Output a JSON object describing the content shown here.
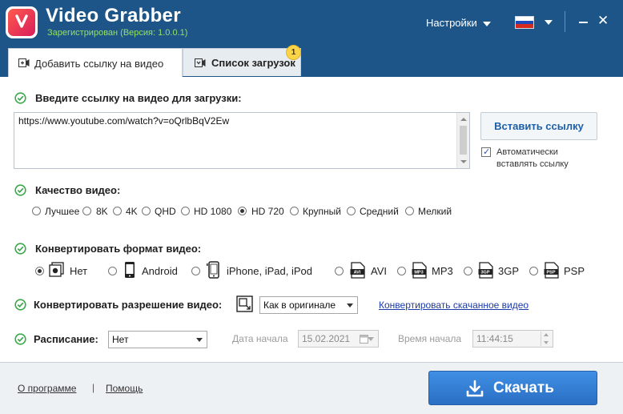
{
  "app": {
    "title": "Video Grabber",
    "subtitle": "Зарегистрирован (Версия: 1.0.0.1)",
    "settings_label": "Настройки",
    "language_flag": "russia-flag-icon"
  },
  "tabs": [
    {
      "label": "Добавить ссылку на видео",
      "active": true,
      "icon": "add-video-icon"
    },
    {
      "label": "Список загрузок",
      "active": false,
      "icon": "download-list-icon",
      "badge": "1"
    }
  ],
  "url_section": {
    "label": "Введите ссылку на видео для загрузки:",
    "value": "https://www.youtube.com/watch?v=oQrlbBqV2Ew",
    "paste_button": "Вставить ссылку",
    "auto_paste_label": "Автоматически вставлять ссылку",
    "auto_paste_checked": true
  },
  "quality": {
    "label": "Качество видео:",
    "options": [
      "Лучшее",
      "8K",
      "4K",
      "QHD",
      "HD 1080",
      "HD 720",
      "Крупный",
      "Средний",
      "Мелкий"
    ],
    "selected": "HD 720"
  },
  "convert_format": {
    "label": "Конвертировать формат видео:",
    "options": [
      {
        "label": "Нет",
        "icon": "no-format-icon"
      },
      {
        "label": "Android",
        "icon": "android-phone-icon"
      },
      {
        "label": "iPhone, iPad, iPod",
        "icon": "iphone-icon"
      },
      {
        "label": "AVI",
        "icon": "avi-file-icon"
      },
      {
        "label": "MP3",
        "icon": "mp3-file-icon"
      },
      {
        "label": "3GP",
        "icon": "3gp-file-icon"
      },
      {
        "label": "PSP",
        "icon": "psp-file-icon"
      }
    ],
    "selected": "Нет"
  },
  "convert_resolution": {
    "label": "Конвертировать разрешение видео:",
    "value": "Как в оригинале",
    "link": "Конвертировать скачанное видео"
  },
  "schedule": {
    "label": "Расписание:",
    "value": "Нет",
    "start_date_label": "Дата начала",
    "start_date": "15.02.2021",
    "start_time_label": "Время начала",
    "start_time": "11:44:15"
  },
  "footer": {
    "about": "О программе",
    "separator": "|",
    "help": "Помощь",
    "download_button": "Скачать"
  },
  "colors": {
    "titlebar": "#1d5589",
    "accent_green": "#3aa74a",
    "primary_button": "#2f7bd4",
    "link": "#1a3aa8"
  }
}
